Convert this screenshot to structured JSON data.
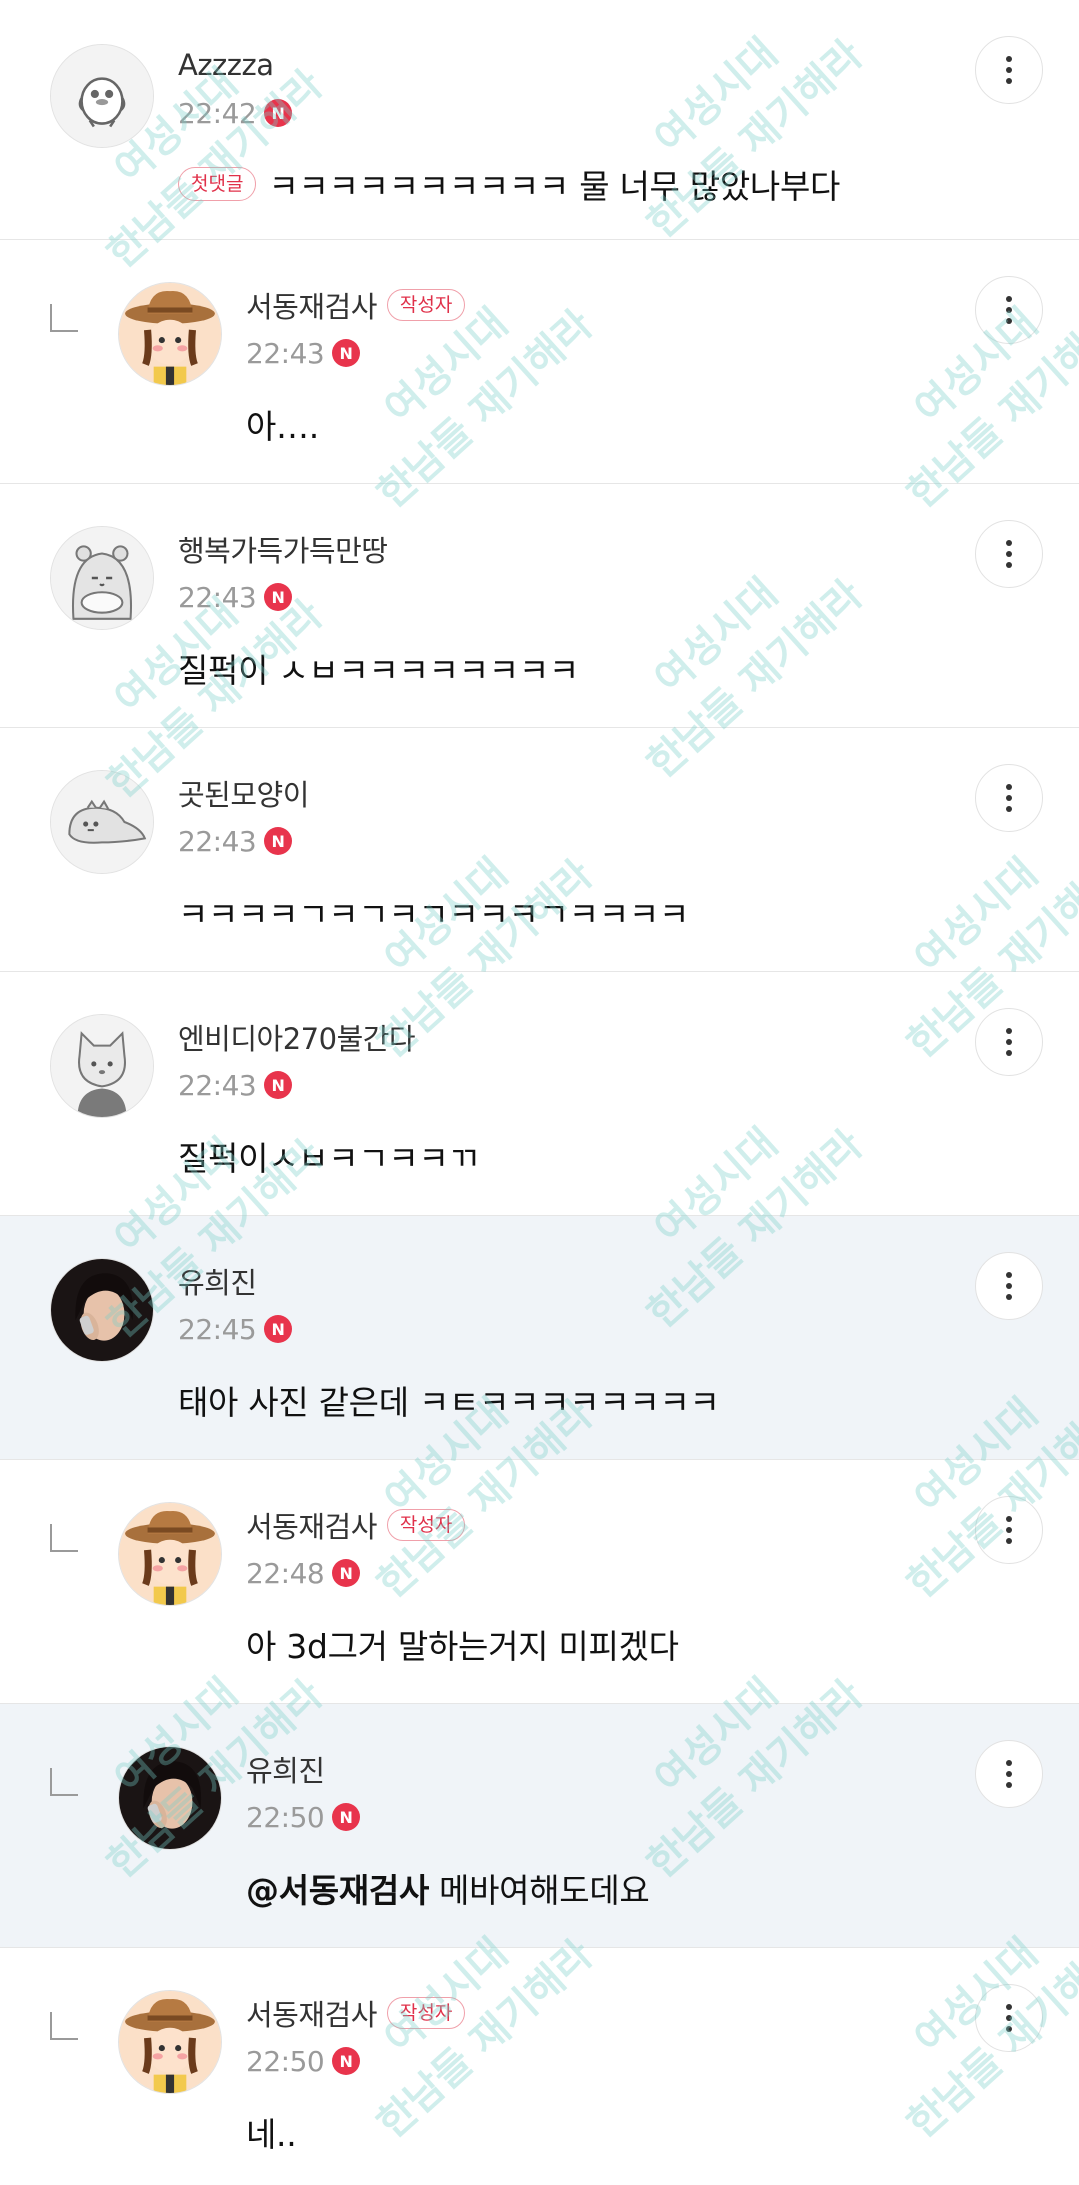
{
  "comments": [
    {
      "nickname": "Azzzza",
      "time": "22:42",
      "new_badge": "N",
      "first_badge": "첫댓글",
      "text": "ㅋㅋㅋㅋㅋㅋㅋㅋㅋㅋ 물 너무 많았나부다",
      "reply": false,
      "author": false,
      "avatar": "bird-avatar"
    },
    {
      "nickname": "서동재검사",
      "author_badge": "작성자",
      "time": "22:43",
      "new_badge": "N",
      "text": "아….",
      "reply": true,
      "author": true,
      "avatar": "cowboy-avatar"
    },
    {
      "nickname": "행복가득가득만땅",
      "time": "22:43",
      "new_badge": "N",
      "text": "질퍽이 ㅅㅂㅋㅋㅋㅋㅋㅋㅋㅋ",
      "reply": false,
      "author": false,
      "avatar": "hippo-avatar"
    },
    {
      "nickname": "곳된모양이",
      "time": "22:43",
      "new_badge": "N",
      "text": "ㅋㅋㅋㅋㄱㅋㄱㅋㄱㅋㅋㅋㄱㅋㅋㅋㅋ",
      "reply": false,
      "author": false,
      "avatar": "dino-avatar"
    },
    {
      "nickname": "엔비디아270불간다",
      "time": "22:43",
      "new_badge": "N",
      "text": "질퍽이ㅅㅂㅋㄱㅋㅋㄲ",
      "reply": false,
      "author": false,
      "avatar": "cat-avatar"
    },
    {
      "nickname": "유희진",
      "time": "22:45",
      "new_badge": "N",
      "text": "태아 사진 같은데 ㅋㅌㅋㅋㅋㅋㅋㅋㅋㅋ",
      "reply": false,
      "author": false,
      "avatar": "photo-avatar",
      "highlight": true
    },
    {
      "nickname": "서동재검사",
      "author_badge": "작성자",
      "time": "22:48",
      "new_badge": "N",
      "text": "아 3d그거 말하는거지 미피겠다",
      "reply": true,
      "author": true,
      "avatar": "cowboy-avatar"
    },
    {
      "nickname": "유희진",
      "time": "22:50",
      "new_badge": "N",
      "mention": "@서동재검사",
      "text": "메바여해도데요",
      "reply": true,
      "author": false,
      "avatar": "photo-avatar",
      "highlight": true
    },
    {
      "nickname": "서동재검사",
      "author_badge": "작성자",
      "time": "22:50",
      "new_badge": "N",
      "text": "네..",
      "reply": true,
      "author": true,
      "avatar": "cowboy-avatar"
    }
  ],
  "watermark": {
    "line1": "여성시대",
    "line2": "한남들 재기해라"
  },
  "colors": {
    "accent": "#e8344c",
    "highlight_bg": "#f0f4f8",
    "watermark": "#78cdc8"
  }
}
